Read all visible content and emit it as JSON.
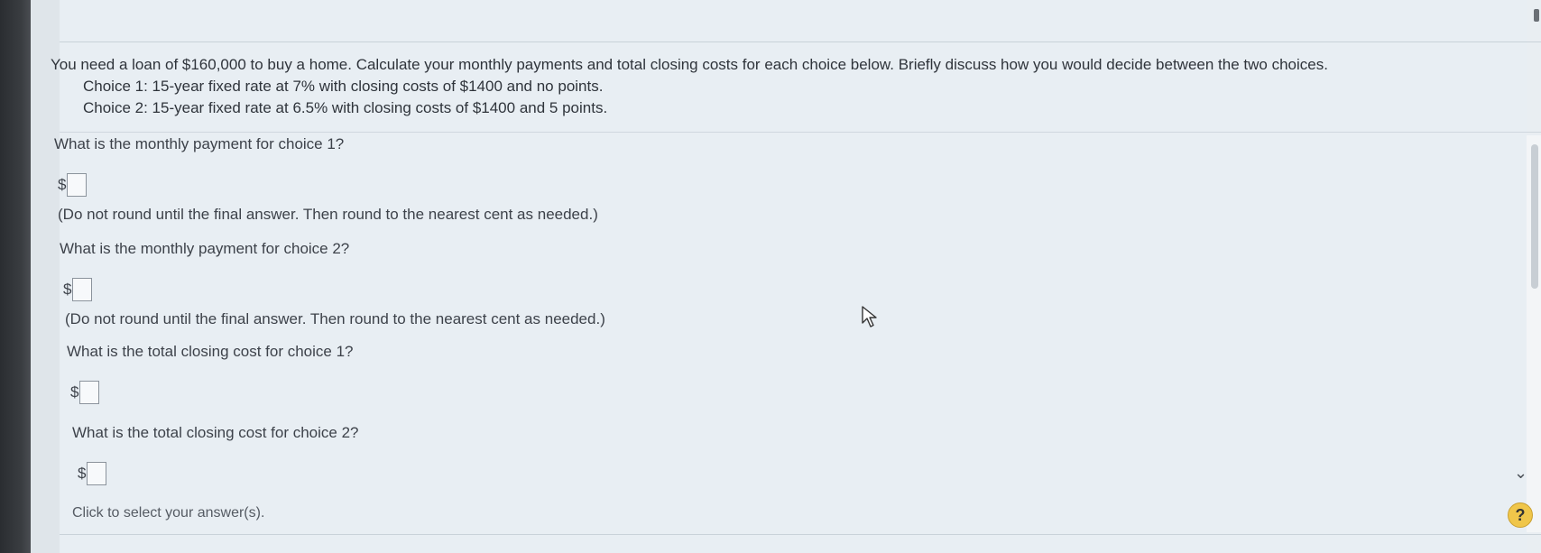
{
  "problem": {
    "intro": "You need a loan of $160,000 to buy a home. Calculate your monthly payments and total closing costs for each choice below. Briefly discuss how you would decide between the two choices.",
    "choice1": "Choice 1: 15-year fixed rate at 7% with closing costs of $1400 and no points.",
    "choice2": "Choice 2: 15-year fixed rate at 6.5% with closing costs of $1400 and 5 points."
  },
  "questions": [
    {
      "label": "What is the monthly payment for choice 1?",
      "currency": "$",
      "value": "",
      "note": "(Do not round until the final answer. Then round to the nearest cent as needed.)"
    },
    {
      "label": "What is the monthly payment for choice 2?",
      "currency": "$",
      "value": "",
      "note": "(Do not round until the final answer. Then round to the nearest cent as needed.)"
    },
    {
      "label": "What is the total closing cost for choice 1?",
      "currency": "$",
      "value": "",
      "note": ""
    },
    {
      "label": "What is the total closing cost for choice 2?",
      "currency": "$",
      "value": "",
      "note": ""
    }
  ],
  "footer": {
    "prompt": "Click to select your answer(s)."
  },
  "help": {
    "label": "?"
  },
  "icons": {
    "scroll": "chevron-down-icon",
    "help": "help-icon",
    "cursor": "mouse-cursor-icon"
  }
}
